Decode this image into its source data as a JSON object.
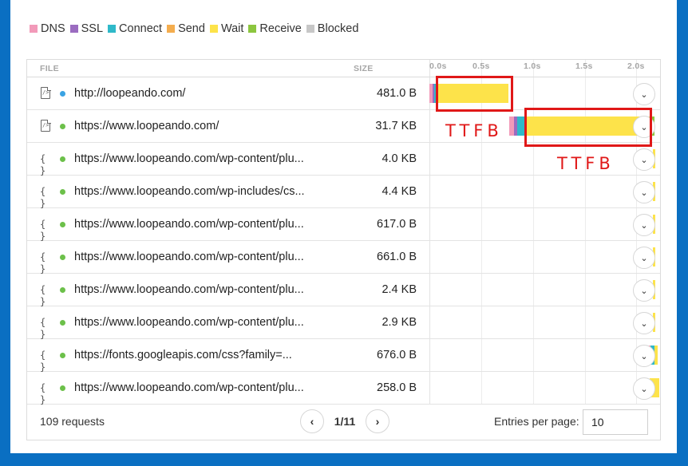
{
  "legend": [
    {
      "label": "DNS",
      "color": "#f29ab9"
    },
    {
      "label": "SSL",
      "color": "#9b6cc0"
    },
    {
      "label": "Connect",
      "color": "#2fb9c9"
    },
    {
      "label": "Send",
      "color": "#f4ad4e"
    },
    {
      "label": "Wait",
      "color": "#fde34a"
    },
    {
      "label": "Receive",
      "color": "#8cc63f"
    },
    {
      "label": "Blocked",
      "color": "#c7c7c7"
    }
  ],
  "header": {
    "file": "FILE",
    "size": "SIZE",
    "ticks": [
      "0.0s",
      "0.5s",
      "1.0s",
      "1.5s",
      "2.0s"
    ]
  },
  "rows": [
    {
      "icon": "document-icon",
      "status_color": "#3aa3e3",
      "url": "http://loopeando.com/",
      "size": "481.0 B"
    },
    {
      "icon": "document-icon",
      "status_color": "#6cc04a",
      "url": "https://www.loopeando.com/",
      "size": "31.7 KB"
    },
    {
      "icon": "braces-icon",
      "status_color": "#6cc04a",
      "url": "https://www.loopeando.com/wp-content/plu...",
      "size": "4.0 KB"
    },
    {
      "icon": "braces-icon",
      "status_color": "#6cc04a",
      "url": "https://www.loopeando.com/wp-includes/cs...",
      "size": "4.4 KB"
    },
    {
      "icon": "braces-icon",
      "status_color": "#6cc04a",
      "url": "https://www.loopeando.com/wp-content/plu...",
      "size": "617.0 B"
    },
    {
      "icon": "braces-icon",
      "status_color": "#6cc04a",
      "url": "https://www.loopeando.com/wp-content/plu...",
      "size": "661.0 B"
    },
    {
      "icon": "braces-icon",
      "status_color": "#6cc04a",
      "url": "https://www.loopeando.com/wp-content/plu...",
      "size": "2.4 KB"
    },
    {
      "icon": "braces-icon",
      "status_color": "#6cc04a",
      "url": "https://www.loopeando.com/wp-content/plu...",
      "size": "2.9 KB"
    },
    {
      "icon": "braces-icon",
      "status_color": "#6cc04a",
      "url": "https://fonts.googleapis.com/css?family=...",
      "size": "676.0 B"
    },
    {
      "icon": "braces-icon",
      "status_color": "#6cc04a",
      "url": "https://www.loopeando.com/wp-content/plu...",
      "size": "258.0 B"
    }
  ],
  "footer": {
    "requests": "109 requests",
    "page": "1/11",
    "entries_label": "Entries per page:",
    "entries_value": "10"
  },
  "annotations": {
    "ttfb_1": "TTFB",
    "ttfb_2": "TTFB"
  },
  "icons": {
    "expand": "chevron-down-icon",
    "prev": "chevron-left-icon",
    "next": "chevron-right-icon"
  }
}
